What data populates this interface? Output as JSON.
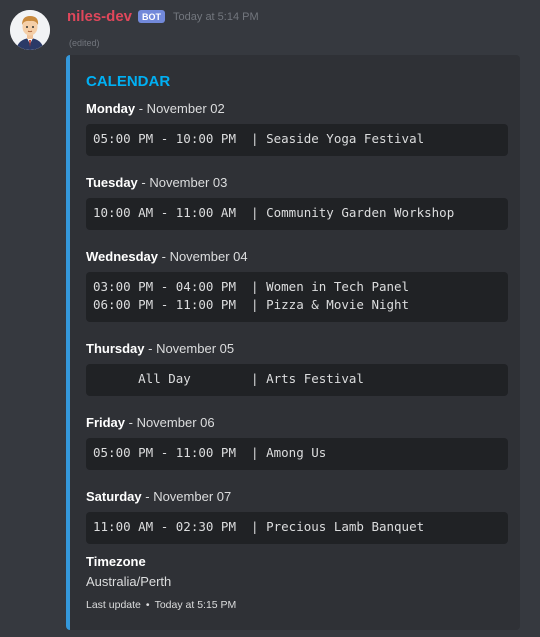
{
  "message": {
    "author": "niles-dev",
    "bot_tag": "BOT",
    "timestamp": "Today at 5:14 PM",
    "edited": "(edited)"
  },
  "embed": {
    "title": "CALENDAR",
    "days": [
      {
        "day": "Monday",
        "date": " - November 02",
        "lines": [
          "05:00 PM - 10:00 PM  | Seaside Yoga Festival"
        ]
      },
      {
        "day": "Tuesday",
        "date": " - November 03",
        "lines": [
          "10:00 AM - 11:00 AM  | Community Garden Workshop"
        ]
      },
      {
        "day": "Wednesday",
        "date": " - November 04",
        "lines": [
          "03:00 PM - 04:00 PM  | Women in Tech Panel",
          "06:00 PM - 11:00 PM  | Pizza & Movie Night"
        ]
      },
      {
        "day": "Thursday",
        "date": " - November 05",
        "lines": [
          "      All Day        | Arts Festival"
        ]
      },
      {
        "day": "Friday",
        "date": " - November 06",
        "lines": [
          "05:00 PM - 11:00 PM  | Among Us"
        ]
      },
      {
        "day": "Saturday",
        "date": " - November 07",
        "lines": [
          "11:00 AM - 02:30 PM  | Precious Lamb Banquet"
        ]
      }
    ],
    "timezone_label": "Timezone",
    "timezone_value": "Australia/Perth",
    "footer_label": "Last update",
    "footer_separator": "•",
    "footer_time": "Today at 5:15 PM",
    "accent_color": "#3498db"
  }
}
